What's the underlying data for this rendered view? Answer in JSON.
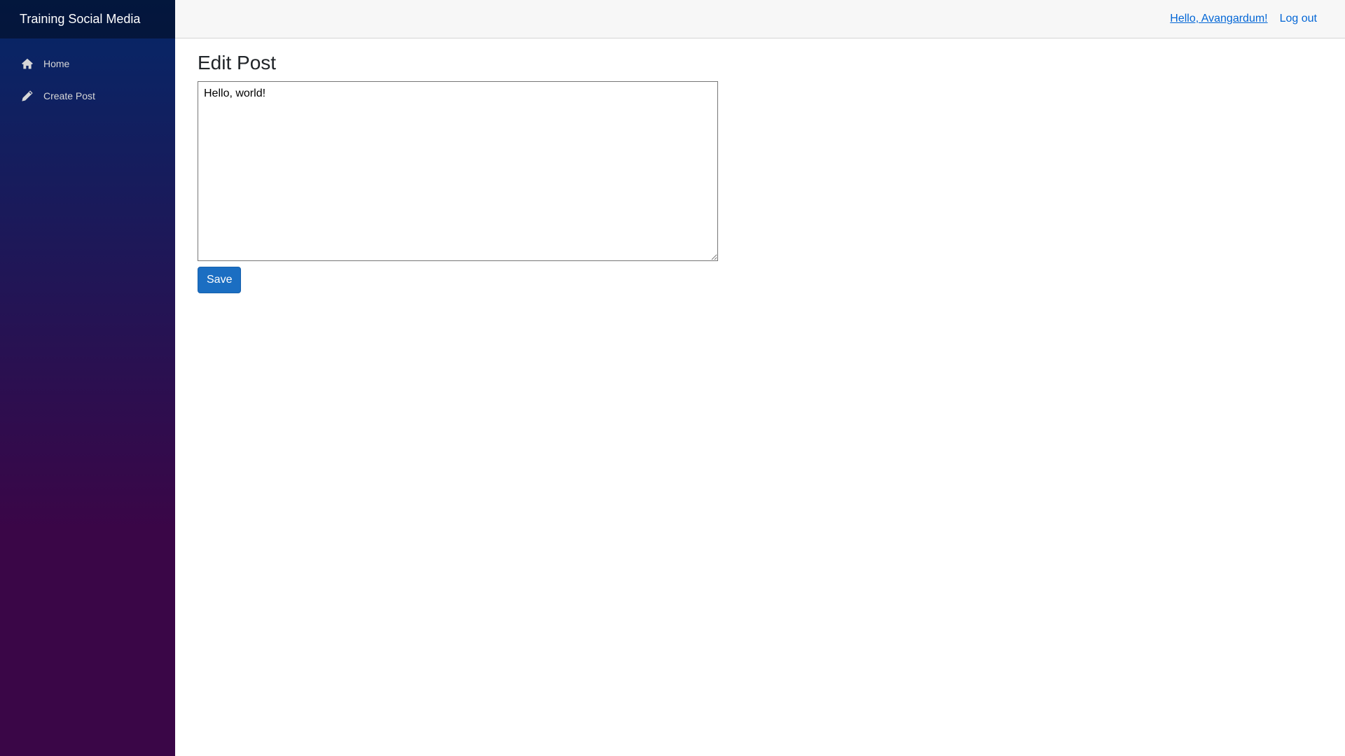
{
  "sidebar": {
    "brand": "Training Social Media",
    "items": [
      {
        "label": "Home",
        "icon": "home-icon"
      },
      {
        "label": "Create Post",
        "icon": "pencil-icon"
      }
    ]
  },
  "topbar": {
    "greeting": "Hello, Avangardum!",
    "logout": "Log out"
  },
  "main": {
    "title": "Edit Post",
    "post_text": "Hello, world!",
    "save_label": "Save"
  },
  "colors": {
    "sidebar_gradient_top": "#052767",
    "sidebar_gradient_bottom": "#3a0647",
    "link": "#0366d6",
    "primary_button": "#1b6ec2"
  }
}
